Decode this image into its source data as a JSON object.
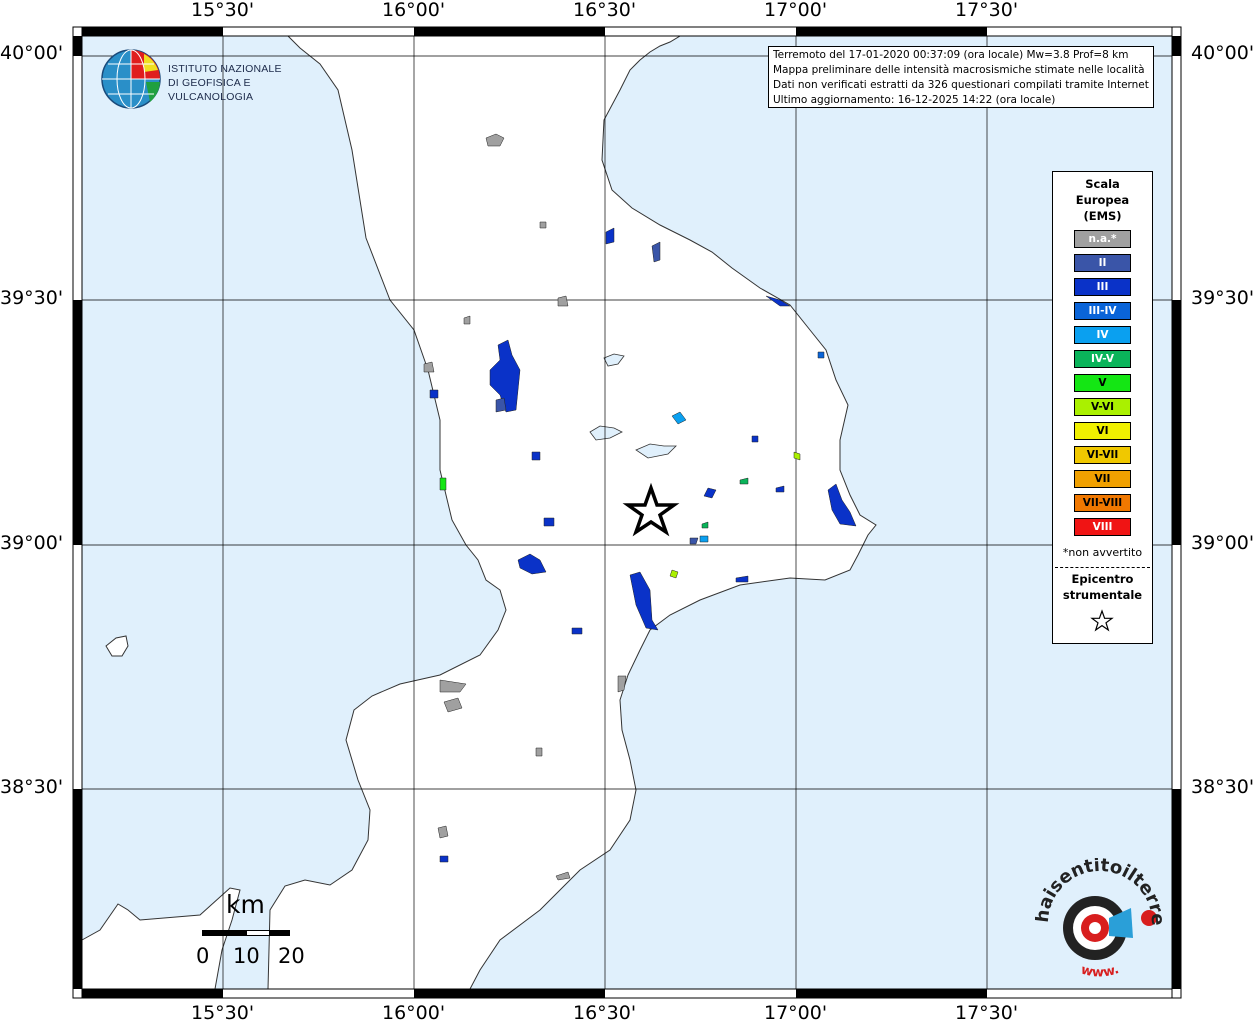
{
  "header": {
    "info_lines": [
      "Terremoto del 17-01-2020 00:37:09 (ora locale) Mw=3.8 Prof=8 km",
      "Mappa preliminare delle intensità macrosismiche stimate nelle località",
      "Dati non verificati estratti da 326 questionari compilati tramite Internet.",
      "Ultimo aggiornamento: 16-12-2025 14:22 (ora locale)"
    ]
  },
  "logo_ingv": {
    "line1": "ISTITUTO NAZIONALE",
    "line2": "DI GEOFISICA E VULCANOLOGIA"
  },
  "axes": {
    "lon_labels": [
      "15°30'",
      "16°00'",
      "16°30'",
      "17°00'",
      "17°30'"
    ],
    "lat_labels": [
      "40°00'",
      "39°30'",
      "39°00'",
      "38°30'"
    ]
  },
  "legend": {
    "title_lines": [
      "Scala",
      "Europea",
      "(EMS)"
    ],
    "items": [
      {
        "label": "n.a.*",
        "color": "#a0a0a0"
      },
      {
        "label": "II",
        "color": "#3a55a8"
      },
      {
        "label": "III",
        "color": "#0a32c8"
      },
      {
        "label": "III-IV",
        "color": "#0a64d8"
      },
      {
        "label": "IV",
        "color": "#0aa0f0"
      },
      {
        "label": "IV-V",
        "color": "#0ab45a"
      },
      {
        "label": "V",
        "color": "#14e614"
      },
      {
        "label": "V-VI",
        "color": "#aaf000"
      },
      {
        "label": "VI",
        "color": "#f0f000"
      },
      {
        "label": "VI-VII",
        "color": "#f0c800"
      },
      {
        "label": "VII",
        "color": "#f0a000"
      },
      {
        "label": "VII-VIII",
        "color": "#f07800"
      },
      {
        "label": "VIII",
        "color": "#f01414"
      }
    ],
    "non_avvertito": "*non avvertito",
    "epicentro_lines": [
      "Epicentro",
      "strumentale"
    ]
  },
  "scale_bar": {
    "unit": "km",
    "ticks": [
      "0",
      "10",
      "20"
    ]
  },
  "colors": {
    "sea": "#e0f0fc",
    "land": "#ffffff",
    "frame": "#000000"
  },
  "hst_logo": {
    "text": "haisentitoilterremoto.it",
    "url_text": "www."
  }
}
